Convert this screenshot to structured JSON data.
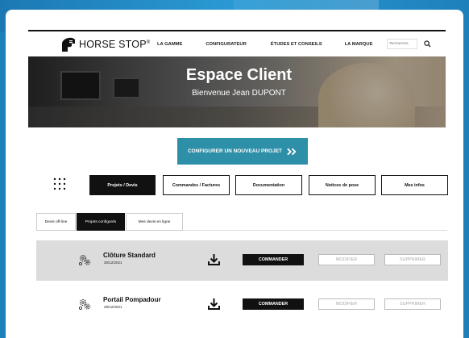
{
  "brand": {
    "name": "HORSE STOP",
    "reg": "®",
    "logo_icon": "horse-head-logo-icon"
  },
  "nav": {
    "items": [
      {
        "label": "LA GAMME"
      },
      {
        "label": "CONFIGURATEUR"
      },
      {
        "label": "ÉTUDES ET CONSEILS"
      },
      {
        "label": "LA MARQUE"
      }
    ],
    "search_placeholder": "Recherche",
    "search_icon": "search-icon"
  },
  "hero": {
    "title": "Espace Client",
    "subtitle": "Bienvenue Jean DUPONT"
  },
  "cta": {
    "label": "CONFIGURER UN NOUVEAU PROJET",
    "icon": "double-chevron-right-icon",
    "color": "#2e8fa8"
  },
  "main_tabs": [
    {
      "label": "Projets / Devis",
      "active": true
    },
    {
      "label": "Commandes / Factures",
      "active": false
    },
    {
      "label": "Documentation",
      "active": false
    },
    {
      "label": "Notices de pose",
      "active": false
    },
    {
      "label": "Mes infos",
      "active": false
    }
  ],
  "sub_tabs": [
    {
      "label": "Devis off-line",
      "active": false
    },
    {
      "label": "Projets configurés",
      "active": true
    },
    {
      "label": "Mes devis en ligne",
      "active": false
    }
  ],
  "projects": [
    {
      "name": "Clôture Standard",
      "date": "30/12/2021",
      "icon": "gear-cluster-icon",
      "download_icon": "download-icon",
      "order_label": "COMMANDER",
      "edit_label": "MODIFIER",
      "delete_label": "SUPPRIMER"
    },
    {
      "name": "Portail Pompadour",
      "date": "29/12/2021",
      "icon": "gear-cluster-icon",
      "download_icon": "download-icon",
      "order_label": "COMMANDER",
      "edit_label": "MODIFIER",
      "delete_label": "SUPPRIMER"
    }
  ],
  "colors": {
    "page_bg": "#1f7fb8",
    "accent": "#2e8fa8",
    "dark": "#111111",
    "row_shade": "#dcdcdc"
  }
}
